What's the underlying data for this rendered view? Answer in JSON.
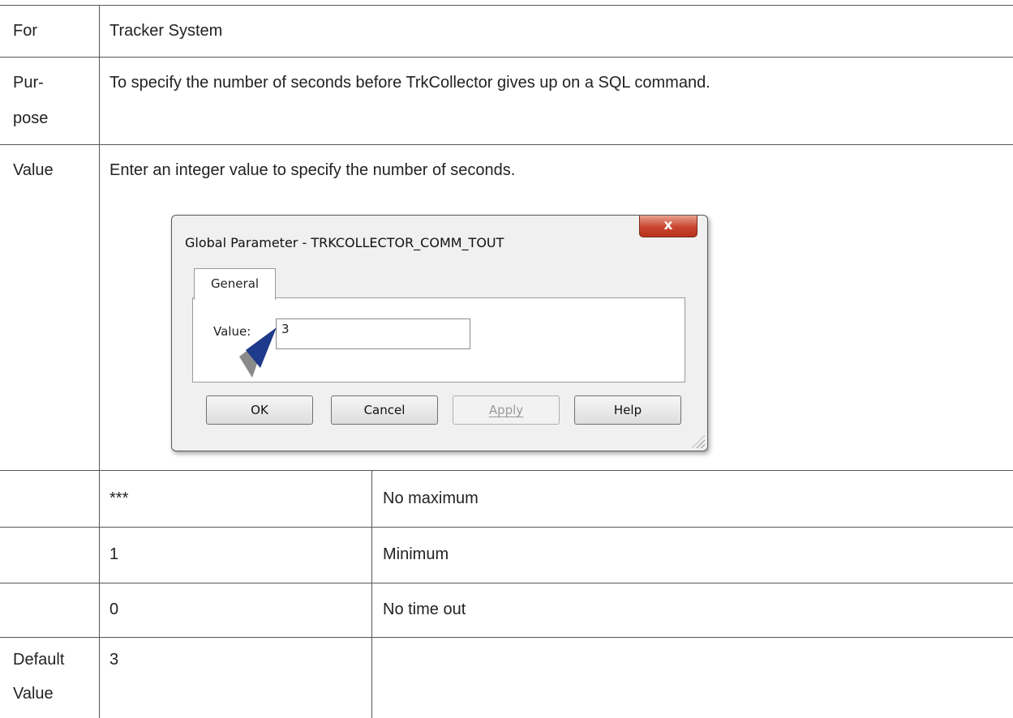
{
  "rows": {
    "for": {
      "label": "For",
      "value": "Tracker System"
    },
    "purpose": {
      "label_line1": "Pur-",
      "label_line2": "pose",
      "value": "To specify the number of seconds before TrkCollector gives up on a SQL command."
    },
    "value": {
      "label": "Value",
      "text": "Enter an integer value to specify the number of seconds."
    },
    "options": [
      {
        "setting": "***",
        "description": "No maximum"
      },
      {
        "setting": "1",
        "description": "Minimum"
      },
      {
        "setting": "0",
        "description": "No time out"
      }
    ],
    "default": {
      "label_line1": "Default",
      "label_line2": "Value",
      "value": "3"
    }
  },
  "dialog": {
    "title": "Global Parameter - TRKCOLLECTOR_COMM_TOUT",
    "close_glyph": "x",
    "tab_label": "General",
    "value_label": "Value:",
    "value_input": "3",
    "buttons": {
      "ok": "OK",
      "cancel": "Cancel",
      "apply": "Apply",
      "help": "Help"
    },
    "pointer_icon": "arrow-pointer-icon",
    "colors": {
      "pointer": "#1e3a8a",
      "close_button": "#c9452e"
    }
  }
}
